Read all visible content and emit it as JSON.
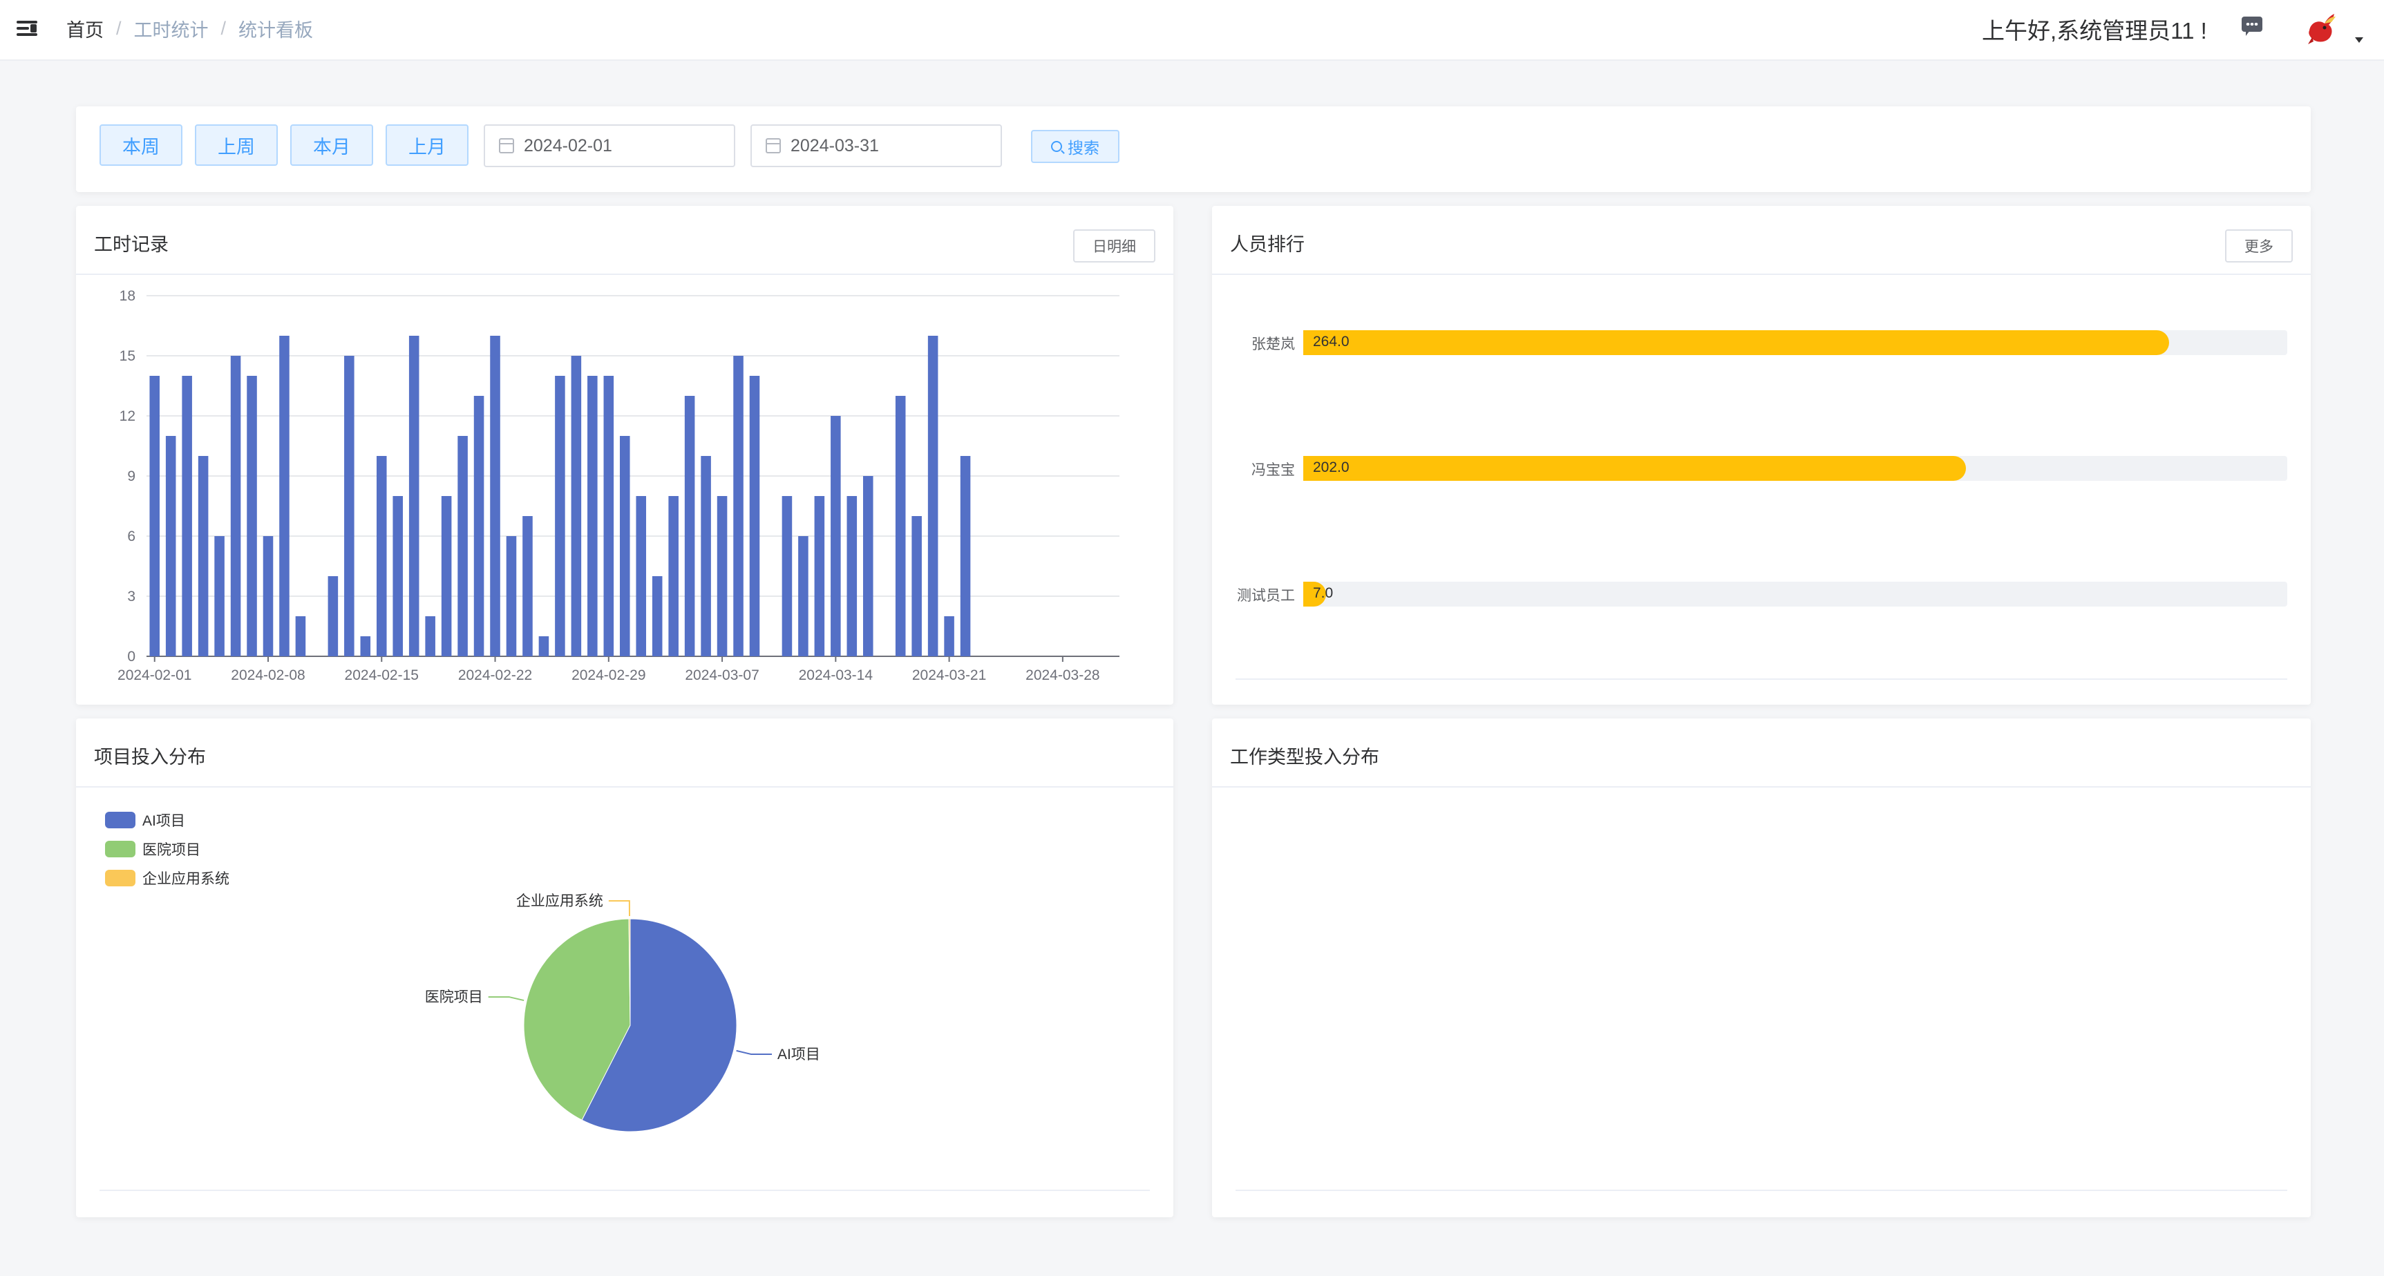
{
  "header": {
    "breadcrumb": [
      "首页",
      "工时统计",
      "统计看板"
    ],
    "greeting": "上午好,系统管理员11 !"
  },
  "filter": {
    "quick_buttons": [
      "本周",
      "上周",
      "本月",
      "上月"
    ],
    "start_date": "2024-02-01",
    "end_date": "2024-03-31",
    "search_label": "搜索"
  },
  "work_records": {
    "title": "工时记录",
    "button": "日明细"
  },
  "ranking": {
    "title": "人员排行",
    "button": "更多",
    "max": 300,
    "items": [
      {
        "name": "张楚岚",
        "value": 264.0,
        "label": "264.0"
      },
      {
        "name": "冯宝宝",
        "value": 202.0,
        "label": "202.0"
      },
      {
        "name": "测试员工",
        "value": 7.0,
        "label": "7.0"
      }
    ],
    "bar_color": "#ffc107"
  },
  "project_dist": {
    "title": "项目投入分布"
  },
  "worktype_dist": {
    "title": "工作类型投入分布"
  },
  "chart_data": [
    {
      "type": "bar",
      "title": "",
      "xlabel": "",
      "ylabel": "",
      "ylim": [
        0,
        18
      ],
      "yticks": [
        0,
        3,
        6,
        9,
        12,
        15,
        18
      ],
      "grid": true,
      "color": "#5470c6",
      "x_tick_labels": [
        "2024-02-01",
        "2024-02-08",
        "2024-02-15",
        "2024-02-22",
        "2024-02-29",
        "2024-03-07",
        "2024-03-14",
        "2024-03-21",
        "2024-03-28"
      ],
      "x": [
        "2024-02-01",
        "2024-02-02",
        "2024-02-03",
        "2024-02-04",
        "2024-02-05",
        "2024-02-06",
        "2024-02-07",
        "2024-02-08",
        "2024-02-09",
        "2024-02-10",
        "2024-02-11",
        "2024-02-12",
        "2024-02-13",
        "2024-02-14",
        "2024-02-15",
        "2024-02-16",
        "2024-02-17",
        "2024-02-18",
        "2024-02-19",
        "2024-02-20",
        "2024-02-21",
        "2024-02-22",
        "2024-02-23",
        "2024-02-24",
        "2024-02-25",
        "2024-02-26",
        "2024-02-27",
        "2024-02-28",
        "2024-02-29",
        "2024-03-01",
        "2024-03-02",
        "2024-03-03",
        "2024-03-04",
        "2024-03-05",
        "2024-03-06",
        "2024-03-07",
        "2024-03-08",
        "2024-03-09",
        "2024-03-10",
        "2024-03-11",
        "2024-03-12",
        "2024-03-13",
        "2024-03-14",
        "2024-03-15",
        "2024-03-16",
        "2024-03-17",
        "2024-03-18",
        "2024-03-19",
        "2024-03-20",
        "2024-03-21",
        "2024-03-22",
        "2024-03-23",
        "2024-03-24",
        "2024-03-25",
        "2024-03-26",
        "2024-03-27",
        "2024-03-28",
        "2024-03-29",
        "2024-03-30",
        "2024-03-31"
      ],
      "values": [
        14,
        11,
        14,
        10,
        6,
        15,
        14,
        6,
        16,
        2,
        0,
        4,
        15,
        1,
        10,
        8,
        16,
        2,
        8,
        11,
        13,
        16,
        6,
        7,
        1,
        14,
        15,
        14,
        14,
        11,
        8,
        4,
        8,
        13,
        10,
        8,
        15,
        14,
        0,
        8,
        6,
        8,
        12,
        8,
        9,
        0,
        13,
        7,
        16,
        2,
        10,
        0,
        0,
        0,
        0,
        0,
        0,
        0,
        0,
        0
      ]
    },
    {
      "type": "pie",
      "title": "",
      "legend": "top-left",
      "categories": [
        "AI项目",
        "医院项目",
        "企业应用系统"
      ],
      "values": [
        57.5,
        42.3,
        0.2
      ],
      "colors": [
        "#5470c6",
        "#91cc75",
        "#fac858"
      ]
    }
  ]
}
